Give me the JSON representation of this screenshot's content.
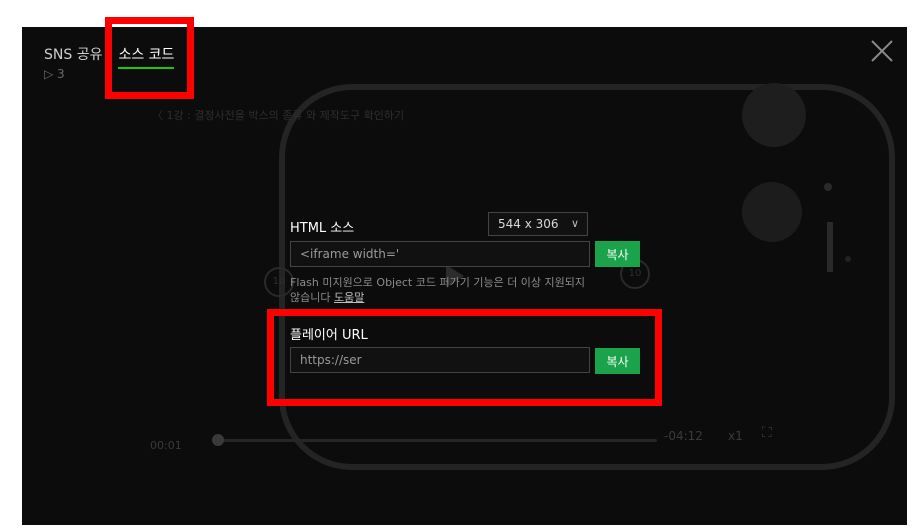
{
  "tabs": [
    {
      "label": "SNS 공유",
      "active": false
    },
    {
      "label": "소스 코드",
      "active": true
    }
  ],
  "view_count": "▷ 3",
  "background_video": {
    "title": "〈 1강 : 결정사전을 박스의 종류 와 제작도구 확인하기",
    "time_current": "00:01",
    "time_remaining": "-04:12",
    "speed": "x1",
    "skip_seconds": "10"
  },
  "html_source": {
    "label": "HTML 소스",
    "size_selected": "544 x 306",
    "code_value": "<iframe width='",
    "copy_label": "복사",
    "notice_text": "Flash 미지원으로 Object 코드 퍼가기 기능은 더 이상 지원되지 않습니다 ",
    "notice_link": "도움말"
  },
  "player_url": {
    "label": "플레이어 URL",
    "value": "https://ser",
    "copy_label": "복사"
  },
  "colors": {
    "accent_green": "#1ec800",
    "copy_button": "#1aa34a",
    "highlight": "#ff0000",
    "overlay": "#0c0c0c"
  },
  "icons": {
    "close": "close-icon",
    "chevron": "chevron-down-icon"
  }
}
